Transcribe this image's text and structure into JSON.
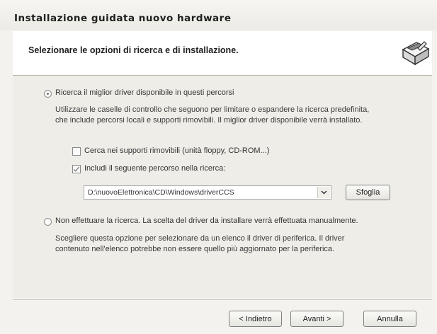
{
  "window": {
    "title": "Installazione guidata nuovo hardware"
  },
  "header": {
    "title": "Selezionare le opzioni di ricerca e di installazione.",
    "icon": "hardware-wizard-icon"
  },
  "options": {
    "search_radio_label": "Ricerca il miglior driver disponibile in questi percorsi",
    "search_radio_selected": true,
    "search_description_line1": "Utilizzare le caselle di controllo che seguono per limitare o espandere la ricerca predefinita,",
    "search_description_line2": "che include percorsi locali e supporti rimovibili. Il miglior driver disponibile verrà installato.",
    "removable_checkbox_label": "Cerca nei supporti rimovibili (unità floppy, CD-ROM...)",
    "removable_checked": false,
    "include_path_checkbox_label": "Includi il seguente percorso nella ricerca:",
    "include_path_checked": true,
    "path_value": "D:\\nuovoElettronica\\CD\\Windows\\driverCCS",
    "browse_label": "Sfoglia",
    "manual_radio_label": "Non effettuare la ricerca. La scelta del driver da installare verrà effettuata manualmente.",
    "manual_radio_selected": false,
    "manual_description_line1": "Scegliere questa opzione per selezionare da un elenco il driver di periferica. Il driver",
    "manual_description_line2": "contenuto nell'elenco potrebbe non essere quello più aggiornato per la periferica."
  },
  "footer": {
    "back_label": "< Indietro",
    "next_label": "Avanti >",
    "cancel_label": "Annulla"
  }
}
